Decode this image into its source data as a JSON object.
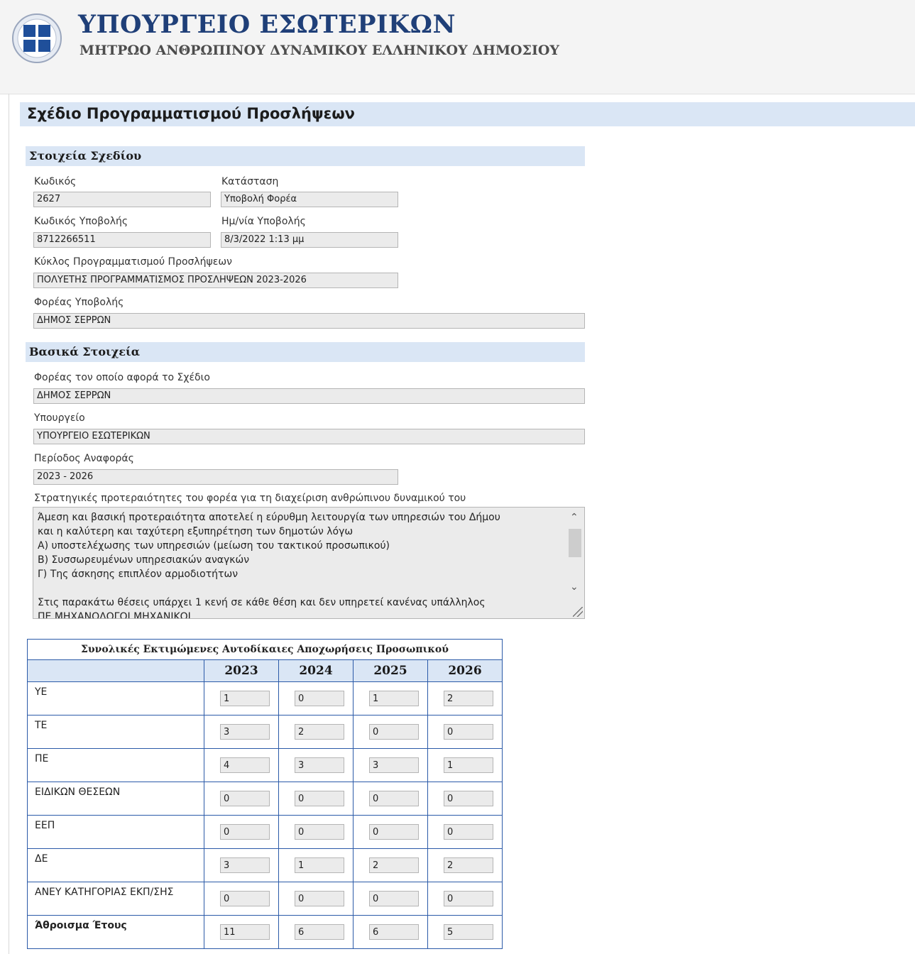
{
  "header": {
    "title": "ΥΠΟΥΡΓΕΙΟ ΕΣΩΤΕΡΙΚΩΝ",
    "subtitle": "ΜΗΤΡΩΟ ΑΝΘΡΩΠΙΝΟΥ ΔΥΝΑΜΙΚΟΥ ΕΛΛΗΝΙΚΟΥ ΔΗΜΟΣΙΟΥ"
  },
  "page": {
    "title": "Σχέδιο Προγραμματισμού Προσλήψεων"
  },
  "plan_section": {
    "title": "Στοιχεία Σχεδίου",
    "code_label": "Κωδικός",
    "code": "2627",
    "status_label": "Κατάσταση",
    "status": "Υποβολή Φορέα",
    "submission_code_label": "Κωδικός Υποβολής",
    "submission_code": "8712266511",
    "submission_date_label": "Ημ/νία Υποβολής",
    "submission_date": "8/3/2022 1:13 μμ",
    "cycle_label": "Κύκλος Προγραμματισμού Προσλήψεων",
    "cycle": "ΠΟΛΥΕΤΗΣ ΠΡΟΓΡΑΜΜΑΤΙΣΜΟΣ ΠΡΟΣΛΗΨΕΩΝ 2023-2026",
    "submitter_label": "Φορέας Υποβολής",
    "submitter": "ΔΗΜΟΣ ΣΕΡΡΩΝ"
  },
  "basic_section": {
    "title": "Βασικά Στοιχεία",
    "entity_label": "Φορέας τον οποίο αφορά το Σχέδιο",
    "entity": "ΔΗΜΟΣ ΣΕΡΡΩΝ",
    "ministry_label": "Υπουργείο",
    "ministry": "ΥΠΟΥΡΓΕΙΟ ΕΣΩΤΕΡΙΚΩΝ",
    "period_label": "Περίοδος Αναφοράς",
    "period": "2023 - 2026",
    "priorities_label": "Στρατηγικές προτεραιότητες του φορέα για τη διαχείριση ανθρώπινου δυναμικού του",
    "priorities_text": "Άμεση και βασική προτεραιότητα αποτελεί η εύρυθμη λειτουργία των υπηρεσιών του Δήμου\nκαι η καλύτερη και ταχύτερη εξυπηρέτηση των δημοτών λόγω\nΑ) υποστελέχωσης των υπηρεσιών (μείωση του τακτικού προσωπικού)\nΒ) Συσσωρευμένων υπηρεσιακών αναγκών\nΓ) Της άσκησης επιπλέον αρμοδιοτήτων\n\nΣτις παρακάτω θέσεις υπάρχει 1 κενή σε κάθε θέση και δεν υπηρετεί κανένας υπάλληλος\nΠΕ ΜΗΧΑΝΟΛΟΓΟΙ ΜΗΧΑΝΙΚΟΙ"
  },
  "retirements": {
    "caption": "Συνολικές Εκτιμώμενες Αυτοδίκαιες Αποχωρήσεις Προσωπικού",
    "years": [
      "2023",
      "2024",
      "2025",
      "2026"
    ],
    "rows": [
      {
        "label": "ΥΕ",
        "values": [
          "1",
          "0",
          "1",
          "2"
        ]
      },
      {
        "label": "ΤΕ",
        "values": [
          "3",
          "2",
          "0",
          "0"
        ]
      },
      {
        "label": "ΠΕ",
        "values": [
          "4",
          "3",
          "3",
          "1"
        ]
      },
      {
        "label": "ΕΙΔΙΚΩΝ ΘΕΣΕΩΝ",
        "values": [
          "0",
          "0",
          "0",
          "0"
        ]
      },
      {
        "label": "ΕΕΠ",
        "values": [
          "0",
          "0",
          "0",
          "0"
        ]
      },
      {
        "label": "ΔΕ",
        "values": [
          "3",
          "1",
          "2",
          "2"
        ]
      },
      {
        "label": "ΑΝΕΥ ΚΑΤΗΓΟΡΙΑΣ ΕΚΠ/ΣΗΣ",
        "values": [
          "0",
          "0",
          "0",
          "0"
        ]
      },
      {
        "label": "Άθροισμα Έτους",
        "values": [
          "11",
          "6",
          "6",
          "5"
        ]
      }
    ]
  }
}
